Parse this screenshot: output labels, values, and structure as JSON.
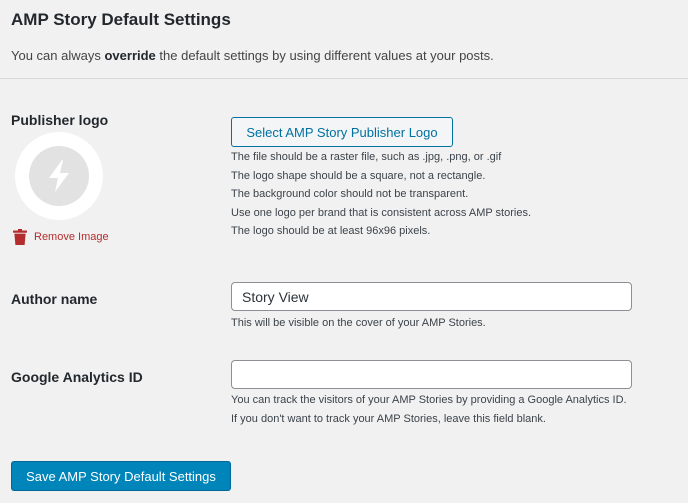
{
  "page": {
    "title": "AMP Story Default Settings",
    "intro_before": "You can always ",
    "intro_bold": "override",
    "intro_after": " the default settings by using different values at your posts."
  },
  "publisher_logo": {
    "label": "Publisher logo",
    "logo_icon": "lightning-bolt-icon",
    "remove_label": "Remove Image",
    "select_button": "Select AMP Story Publisher Logo",
    "notes": [
      "The file should be a raster file, such as .jpg, .png, or .gif",
      "The logo shape should be a square, not a rectangle.",
      "The background color should not be transparent.",
      "Use one logo per brand that is consistent across AMP stories.",
      "The logo should be at least 96x96 pixels."
    ]
  },
  "author": {
    "label": "Author name",
    "value": "Story View",
    "hint": "This will be visible on the cover of your AMP Stories."
  },
  "analytics": {
    "label": "Google Analytics ID",
    "value": "",
    "hint_1": "You can track the visitors of your AMP Stories by providing a Google Analytics ID.",
    "hint_2": "If you don't want to track your AMP Stories, leave this field blank."
  },
  "save_button": "Save AMP Story Default Settings",
  "colors": {
    "background": "#f1f1f1",
    "primary": "#0085ba",
    "link": "#0071a1",
    "danger": "#b32d2e"
  }
}
